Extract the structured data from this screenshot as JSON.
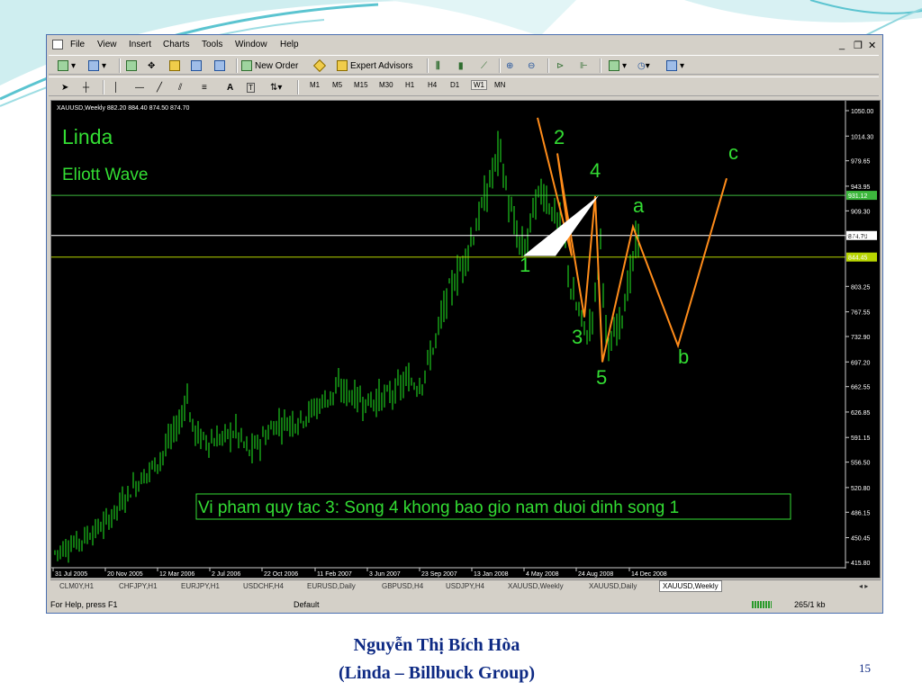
{
  "menu": {
    "items": [
      "File",
      "View",
      "Insert",
      "Charts",
      "Tools",
      "Window",
      "Help"
    ],
    "window_controls": [
      "_",
      "❐",
      "✕"
    ]
  },
  "toolbar": {
    "new_order_label": "New Order",
    "expert_advisors_label": "Expert Advisors",
    "timeframes": [
      "M1",
      "M5",
      "M15",
      "M30",
      "H1",
      "H4",
      "D1",
      "W1",
      "MN"
    ],
    "active_timeframe": "W1"
  },
  "chart": {
    "info_text": "XAUUSD,Weekly  882.20 884.40 874.50 874.70",
    "title": "Linda",
    "subtitle": "Eliott Wave",
    "annotation": "Vi pham quy tac 3: Song 4 khong bao gio nam duoi dinh song 1",
    "price_labels": [
      "1050.00",
      "1014.30",
      "979.65",
      "943.95",
      "909.30",
      "874.70",
      "803.25",
      "767.55",
      "732.90",
      "697.20",
      "662.55",
      "626.85",
      "591.15",
      "556.50",
      "520.80",
      "486.15",
      "450.45",
      "415.80"
    ],
    "highlight_prices": [
      {
        "value": "931.12",
        "color": "#3db83d"
      },
      {
        "value": "874.70",
        "color": "#ffffff"
      },
      {
        "value": "844.45",
        "color": "#b8d600"
      }
    ],
    "time_labels": [
      "31 Jul 2005",
      "20 Nov 2005",
      "12 Mar 2006",
      "2 Jul 2006",
      "22 Oct 2006",
      "11 Feb 2007",
      "3 Jun 2007",
      "23 Sep 2007",
      "13 Jan 2008",
      "4 May 2008",
      "24 Aug 2008",
      "14 Dec 2008"
    ],
    "wave_labels": [
      "1",
      "2",
      "3",
      "4",
      "5",
      "a",
      "b",
      "c"
    ],
    "colors": {
      "text": "#33dd33",
      "wave": "#ff8c1a",
      "candle": "#22ee22",
      "label": "#33dd33"
    }
  },
  "tabs": {
    "items": [
      "CLM0Y,H1",
      "CHFJPY,H1",
      "EURJPY,H1",
      "USDCHF,H4",
      "EURUSD,Daily",
      "GBPUSD,H4",
      "USDJPY,H4",
      "XAUUSD,Weekly",
      "XAUUSD,Daily",
      "XAUUSD,Weekly"
    ],
    "active_index": 9
  },
  "status": {
    "help": "For Help, press F1",
    "profile": "Default",
    "traffic": "265/1 kb"
  },
  "footer": {
    "author": "Nguyễn Thị Bích Hòa",
    "group": "(Linda – Billbuck Group)",
    "page_number": "15"
  }
}
